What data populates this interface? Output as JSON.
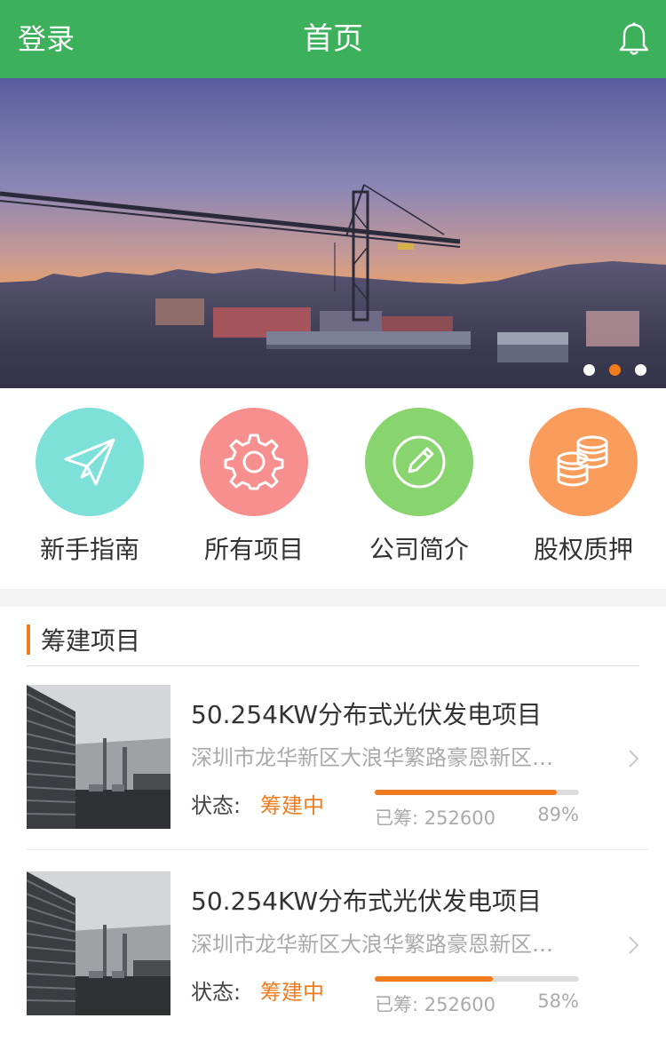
{
  "header": {
    "login_label": "登录",
    "title": "首页",
    "icon": "bell-icon"
  },
  "banner": {
    "dots": 3,
    "active_dot": 2
  },
  "quick_nav": [
    {
      "label": "新手指南",
      "icon": "paper-plane-icon",
      "color": "#7de1d9"
    },
    {
      "label": "所有项目",
      "icon": "gear-icon",
      "color": "#f88f8f"
    },
    {
      "label": "公司简介",
      "icon": "pencil-icon",
      "color": "#88d46f"
    },
    {
      "label": "股权质押",
      "icon": "coins-icon",
      "color": "#f99c5c"
    }
  ],
  "section": {
    "title": "筹建项目"
  },
  "projects": [
    {
      "name": "50.254KW分布式光伏发电项目",
      "address": "深圳市龙华新区大浪华繁路豪恩新区…",
      "status_label": "状态:",
      "status": "筹建中",
      "raised_label": "已筹:",
      "raised": "252600",
      "percent_text": "89%",
      "progress": 0.89
    },
    {
      "name": "50.254KW分布式光伏发电项目",
      "address": "深圳市龙华新区大浪华繁路豪恩新区…",
      "status_label": "状态:",
      "status": "筹建中",
      "raised_label": "已筹:",
      "raised": "252600",
      "percent_text": "58%",
      "progress": 0.58
    }
  ],
  "colors": {
    "header": "#3db05c",
    "accent": "#f07c1e"
  }
}
